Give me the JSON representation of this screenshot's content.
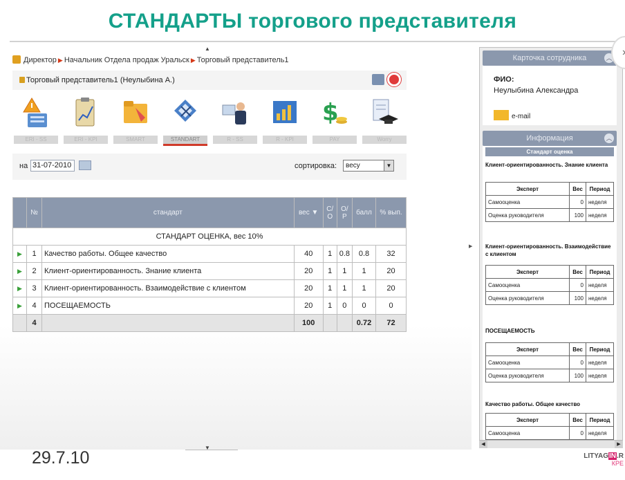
{
  "slide": {
    "title": "СТАНДАРТЫ торгового представителя",
    "date": "29.7.10",
    "watermark_top_pre": "LITYAG",
    "watermark_top_hl": "IN",
    "watermark_top_post": ".R",
    "watermark_bottom": "КРЕ"
  },
  "breadcrumb": {
    "items": [
      "Директор",
      "Начальник Отдела продаж Уральск",
      "Торговый представитель1"
    ]
  },
  "rep": {
    "name": "Торговый представитель1  (Неулыбина А.)"
  },
  "toolbar": {
    "tabs": [
      {
        "label": "ERI - SS",
        "icon": "warning-icon"
      },
      {
        "label": "ERI - KPI",
        "icon": "clipboard-chart-icon"
      },
      {
        "label": "SMART",
        "icon": "folder-icon"
      },
      {
        "label": "STANDART",
        "icon": "compass-ruler-icon",
        "active": true
      },
      {
        "label": "R - SS",
        "icon": "meeting-icon"
      },
      {
        "label": "R - KPI",
        "icon": "bar-chart-icon"
      },
      {
        "label": "PAY",
        "icon": "dollar-coins-icon"
      },
      {
        "label": "Worry",
        "icon": "graduation-cap-icon"
      }
    ]
  },
  "filters": {
    "date_label": "на",
    "date_value": "31-07-2010",
    "sort_label": "сортировка:",
    "sort_value": "весу"
  },
  "table": {
    "headers": {
      "num": "№",
      "standard": "стандарт",
      "weight": "вес",
      "so": "С/О",
      "op": "О/Р",
      "score": "балл",
      "pct": "% вып."
    },
    "group_label": "СТАНДАРТ ОЦЕНКА, вес 10%",
    "rows": [
      {
        "num": "1",
        "name": "Качество работы. Общее качество",
        "weight": "40",
        "so": "1",
        "op": "0.8",
        "score": "0.8",
        "pct": "32"
      },
      {
        "num": "2",
        "name": "Клиент-ориентированность. Знание клиента",
        "weight": "20",
        "so": "1",
        "op": "1",
        "score": "1",
        "pct": "20"
      },
      {
        "num": "3",
        "name": "Клиент-ориентированность. Взаимодействие с клиентом",
        "weight": "20",
        "so": "1",
        "op": "1",
        "score": "1",
        "pct": "20"
      },
      {
        "num": "4",
        "name": "ПОСЕЩАЕМОСТЬ",
        "weight": "20",
        "so": "1",
        "op": "0",
        "score": "0",
        "pct": "0"
      }
    ],
    "total": {
      "num": "4",
      "weight": "100",
      "score": "0.72",
      "pct": "72"
    }
  },
  "card": {
    "title": "Карточка сотрудника",
    "fio_label": "ФИО:",
    "fio_value": "Неулыбина Александра",
    "email": "e-mail"
  },
  "info": {
    "title": "Информация",
    "subheader": "Стандарт оценка",
    "mini_headers": {
      "expert": "Эксперт",
      "weight": "Вес",
      "period": "Период"
    },
    "sections": [
      {
        "title": "Клиент-ориентированность. Знание клиента",
        "rows": [
          {
            "expert": "Самооценка",
            "weight": "0",
            "period": "неделя"
          },
          {
            "expert": "Оценка руководителя",
            "weight": "100",
            "period": "неделя"
          }
        ]
      },
      {
        "title": "Клиент-ориентированность. Взаимодействие с клиентом",
        "rows": [
          {
            "expert": "Самооценка",
            "weight": "0",
            "period": "неделя"
          },
          {
            "expert": "Оценка руководителя",
            "weight": "100",
            "period": "неделя"
          }
        ]
      },
      {
        "title": "ПОСЕЩАЕМОСТЬ",
        "rows": [
          {
            "expert": "Самооценка",
            "weight": "0",
            "period": "неделя"
          },
          {
            "expert": "Оценка руководителя",
            "weight": "100",
            "period": "неделя"
          }
        ]
      },
      {
        "title": "Качество работы. Общее качество",
        "rows": [
          {
            "expert": "Самооценка",
            "weight": "0",
            "period": "неделя"
          }
        ]
      }
    ]
  },
  "colors": {
    "title": "#14a08a",
    "header": "#8b98ad",
    "accent_red": "#d03a2a",
    "play_green": "#3aa03a"
  }
}
